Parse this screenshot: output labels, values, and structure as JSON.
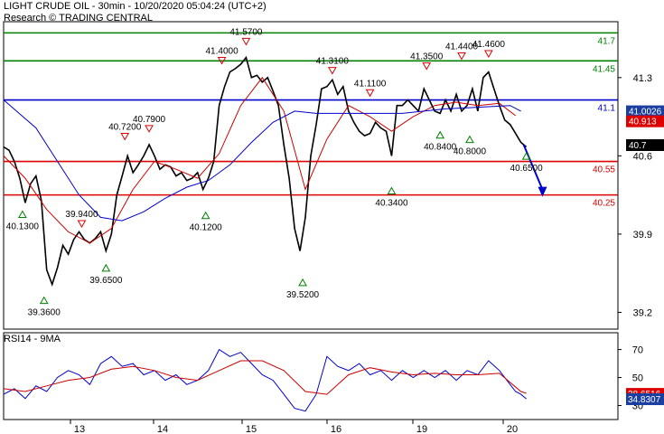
{
  "header": {
    "title": "LIGHT CRUDE OIL - 30min - 10/20/2020 05:04:24 (UTC+2)",
    "subtitle": "Research © TRADING CENTRAL"
  },
  "colors": {
    "price": "#000000",
    "ma_fast": "#cc0000",
    "ma_slow": "#0000cc",
    "resistance": "#008000",
    "pivot": "#0000cc",
    "support": "#dd0000",
    "arrow": "#0000cc",
    "badge_blue": "#1a3fa0",
    "badge_red": "#dd0000",
    "badge_black": "#000000"
  },
  "chart_data": [
    {
      "type": "line",
      "panel": "price",
      "y_ticks": [
        "41.3",
        "40.6",
        "39.9",
        "39.2"
      ],
      "x_ticks": [
        "13",
        "14",
        "15",
        "16",
        "19",
        "20"
      ],
      "ylim": [
        39.05,
        41.8
      ],
      "xlim": [
        0,
        114
      ],
      "levels": [
        {
          "value": 41.7,
          "label": "41.7",
          "color": "#008000"
        },
        {
          "value": 41.45,
          "label": "41.45",
          "color": "#008000"
        },
        {
          "value": 41.1,
          "label": "41.1",
          "color": "#0000cc"
        },
        {
          "value": 40.55,
          "label": "40.55",
          "color": "#dd0000"
        },
        {
          "value": 40.25,
          "label": "40.25",
          "color": "#dd0000"
        }
      ],
      "badges": [
        {
          "value": 41.0026,
          "label": "41.0026",
          "bg": "#1a3fa0"
        },
        {
          "value": 40.913,
          "label": "40.913",
          "bg": "#dd0000"
        },
        {
          "value": 40.7,
          "label": "40.7",
          "bg": "#000000"
        }
      ],
      "extremes": [
        {
          "x": 3.5,
          "value": 40.13,
          "label": "40.1300",
          "kind": "low"
        },
        {
          "x": 7.5,
          "value": 39.36,
          "label": "39.3600",
          "kind": "low"
        },
        {
          "x": 14.5,
          "value": 39.94,
          "label": "39.9400",
          "kind": "high"
        },
        {
          "x": 19,
          "value": 39.65,
          "label": "39.6500",
          "kind": "low"
        },
        {
          "x": 22.5,
          "value": 40.72,
          "label": "40.7200",
          "kind": "high"
        },
        {
          "x": 27,
          "value": 40.79,
          "label": "40.7900",
          "kind": "high"
        },
        {
          "x": 37.5,
          "value": 40.12,
          "label": "40.1200",
          "kind": "low"
        },
        {
          "x": 40.5,
          "value": 41.4,
          "label": "41.4000",
          "kind": "high"
        },
        {
          "x": 45,
          "value": 41.57,
          "label": "41.5700",
          "kind": "high"
        },
        {
          "x": 55.5,
          "value": 39.52,
          "label": "39.5200",
          "kind": "low"
        },
        {
          "x": 61,
          "value": 41.31,
          "label": "41.3100",
          "kind": "high"
        },
        {
          "x": 68,
          "value": 41.11,
          "label": "41.1100",
          "kind": "high"
        },
        {
          "x": 72,
          "value": 40.34,
          "label": "40.3400",
          "kind": "low"
        },
        {
          "x": 78.5,
          "value": 41.35,
          "label": "41.3500",
          "kind": "high"
        },
        {
          "x": 81,
          "value": 40.84,
          "label": "40.8400",
          "kind": "low"
        },
        {
          "x": 85,
          "value": 41.44,
          "label": "41.4400",
          "kind": "high"
        },
        {
          "x": 86.5,
          "value": 40.8,
          "label": "40.8000",
          "kind": "low"
        },
        {
          "x": 90,
          "value": 41.46,
          "label": "41.4600",
          "kind": "high"
        },
        {
          "x": 97,
          "value": 40.65,
          "label": "40.6500",
          "kind": "low"
        }
      ],
      "forecast_arrow": {
        "from": [
          96.5,
          40.7
        ],
        "to": [
          100,
          40.25
        ]
      },
      "series": [
        {
          "color": "#000000",
          "x": [
            0,
            1,
            2,
            3,
            4,
            5,
            6,
            7,
            8,
            9,
            10,
            11,
            12,
            13,
            14,
            15,
            16,
            17,
            18,
            19,
            20,
            21,
            22,
            23,
            24,
            25,
            26,
            27,
            28,
            29,
            30,
            31,
            32,
            33,
            34,
            35,
            36,
            37,
            38,
            39,
            40,
            41,
            42,
            43,
            44,
            45,
            46,
            47,
            48,
            49,
            50,
            51,
            52,
            53,
            54,
            55,
            56,
            57,
            58,
            59,
            60,
            61,
            62,
            63,
            64,
            65,
            66,
            67,
            68,
            69,
            70,
            71,
            72,
            73,
            74,
            75,
            76,
            77,
            78,
            79,
            80,
            81,
            82,
            83,
            84,
            85,
            86,
            87,
            88,
            89,
            90,
            91,
            92,
            93,
            94,
            95,
            96,
            97
          ],
          "values": [
            40.68,
            40.65,
            40.55,
            40.4,
            40.18,
            40.35,
            40.42,
            40.2,
            39.58,
            39.45,
            39.6,
            39.8,
            39.72,
            39.85,
            39.92,
            39.85,
            39.82,
            39.86,
            39.92,
            39.75,
            39.9,
            40.25,
            40.42,
            40.6,
            40.45,
            40.52,
            40.6,
            40.7,
            40.6,
            40.48,
            40.52,
            40.5,
            40.42,
            40.45,
            40.38,
            40.4,
            40.45,
            40.3,
            40.4,
            40.55,
            41.05,
            41.22,
            41.35,
            41.38,
            41.42,
            41.48,
            41.3,
            41.32,
            41.26,
            41.3,
            41.18,
            41.05,
            40.7,
            40.4,
            39.95,
            39.75,
            40.05,
            40.6,
            40.88,
            41.2,
            41.22,
            41.28,
            41.15,
            41.22,
            41.0,
            40.9,
            40.82,
            40.78,
            40.8,
            40.9,
            40.85,
            40.82,
            40.6,
            41.05,
            41.05,
            41.1,
            41.05,
            41.0,
            41.2,
            41.1,
            41.0,
            40.98,
            41.1,
            41.0,
            41.15,
            41.0,
            41.05,
            41.2,
            41.0,
            41.3,
            41.35,
            41.2,
            41.05,
            40.92,
            40.88,
            40.8,
            40.72,
            40.68
          ]
        },
        {
          "color": "#cc0000",
          "x": [
            0,
            4,
            8,
            12,
            16,
            20,
            24,
            28,
            32,
            36,
            40,
            44,
            48,
            52,
            56,
            60,
            64,
            68,
            72,
            76,
            80,
            84,
            88,
            92,
            95
          ],
          "values": [
            40.6,
            40.4,
            40.12,
            39.92,
            39.82,
            39.95,
            40.3,
            40.55,
            40.48,
            40.4,
            40.62,
            41.05,
            41.3,
            41.0,
            40.3,
            40.75,
            41.05,
            40.95,
            40.82,
            40.95,
            41.05,
            41.08,
            41.05,
            41.07,
            40.96
          ]
        },
        {
          "color": "#0000cc",
          "x": [
            0,
            6,
            10,
            14,
            18,
            22,
            26,
            30,
            34,
            38,
            42,
            46,
            50,
            54,
            58,
            62,
            66,
            70,
            74,
            78,
            82,
            86,
            90,
            94,
            96
          ],
          "values": [
            41.1,
            40.85,
            40.55,
            40.25,
            40.05,
            40.02,
            40.1,
            40.22,
            40.32,
            40.38,
            40.52,
            40.72,
            40.9,
            41.0,
            40.98,
            40.98,
            40.98,
            40.98,
            40.98,
            41.0,
            41.02,
            41.03,
            41.04,
            41.05,
            41.0
          ]
        }
      ]
    },
    {
      "type": "line",
      "panel": "rsi",
      "title": "RSI14 - 9MA",
      "y_ticks": [
        "70",
        "50",
        "30"
      ],
      "ylim": [
        20,
        82
      ],
      "xlim": [
        0,
        114
      ],
      "badges": [
        {
          "value": 38.6516,
          "label": "38.6516",
          "bg": "#dd0000"
        },
        {
          "value": 34.8307,
          "label": "34.8307",
          "bg": "#1a3fa0"
        }
      ],
      "series": [
        {
          "color": "#0000cc",
          "x": [
            0,
            2,
            4,
            6,
            8,
            10,
            12,
            14,
            16,
            18,
            20,
            22,
            24,
            26,
            28,
            30,
            32,
            34,
            36,
            38,
            40,
            42,
            44,
            46,
            48,
            50,
            52,
            54,
            56,
            58,
            60,
            62,
            64,
            66,
            68,
            70,
            72,
            74,
            76,
            78,
            80,
            82,
            84,
            86,
            88,
            90,
            92,
            94,
            95,
            96,
            97
          ],
          "values": [
            38,
            42,
            35,
            44,
            40,
            50,
            55,
            52,
            45,
            60,
            65,
            58,
            60,
            52,
            55,
            48,
            52,
            45,
            48,
            55,
            70,
            65,
            68,
            60,
            52,
            48,
            38,
            28,
            26,
            38,
            65,
            58,
            55,
            60,
            52,
            55,
            48,
            55,
            50,
            55,
            50,
            55,
            48,
            55,
            52,
            62,
            55,
            45,
            40,
            38,
            34.8
          ]
        },
        {
          "color": "#cc0000",
          "x": [
            0,
            4,
            8,
            12,
            16,
            20,
            24,
            28,
            32,
            36,
            40,
            44,
            48,
            52,
            56,
            60,
            64,
            68,
            72,
            76,
            80,
            84,
            88,
            92,
            96,
            97
          ],
          "values": [
            42,
            40,
            44,
            48,
            50,
            56,
            58,
            55,
            50,
            48,
            55,
            62,
            62,
            55,
            40,
            38,
            52,
            57,
            54,
            52,
            53,
            52,
            52,
            53,
            40,
            38.7
          ]
        }
      ]
    }
  ]
}
